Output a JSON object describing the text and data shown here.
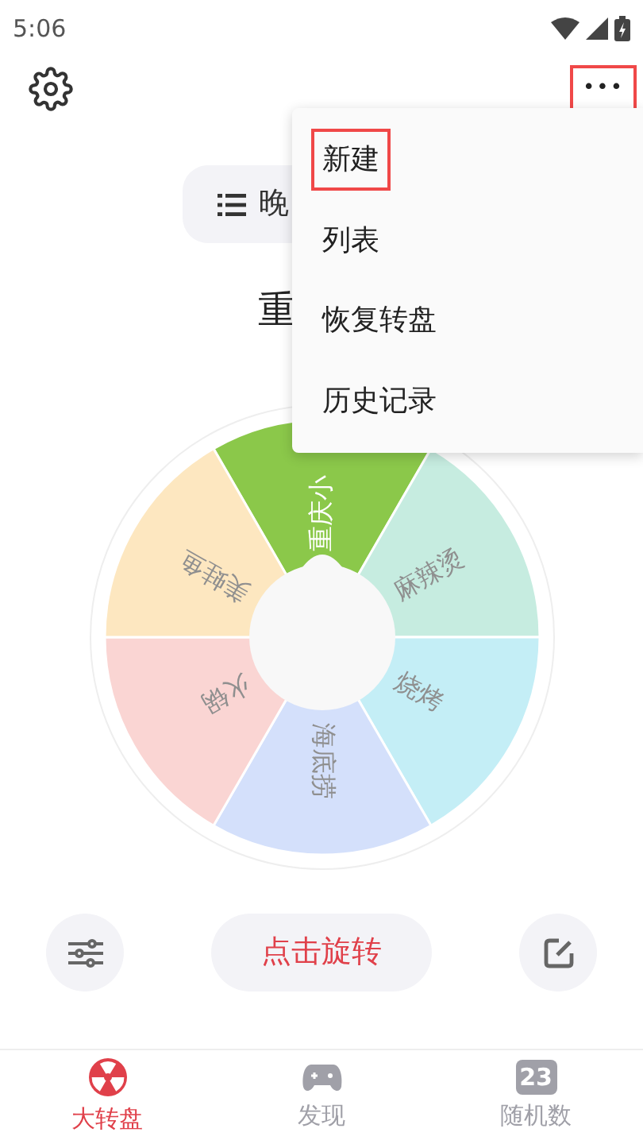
{
  "status_bar": {
    "time": "5:06"
  },
  "header": {
    "more_button": {
      "label": "•••",
      "highlighted": true
    }
  },
  "list_pill": {
    "label": "晚"
  },
  "result_title": "重",
  "wheel": {
    "sectors": [
      {
        "label": "重庆小",
        "color": "#8bc84a"
      },
      {
        "label": "麻辣烫",
        "color": "#c6ece0"
      },
      {
        "label": "烧烤",
        "color": "#c4eef6"
      },
      {
        "label": "海底捞",
        "color": "#d4e0fb"
      },
      {
        "label": "火锅",
        "color": "#fad5d3"
      },
      {
        "label": "美蛙鱼",
        "color": "#fde7c0"
      }
    ]
  },
  "spin_button": {
    "label": "点击旋转"
  },
  "menu": {
    "items": [
      {
        "label": "新建",
        "highlighted": true
      },
      {
        "label": "列表",
        "highlighted": false
      },
      {
        "label": "恢复转盘",
        "highlighted": false
      },
      {
        "label": "历史记录",
        "highlighted": false
      }
    ]
  },
  "tabs": [
    {
      "label": "大转盘",
      "kind": "wheel",
      "selected": true
    },
    {
      "label": "发现",
      "kind": "game",
      "selected": false
    },
    {
      "label": "随机数",
      "kind": "number",
      "badge": "23",
      "selected": false
    }
  ]
}
